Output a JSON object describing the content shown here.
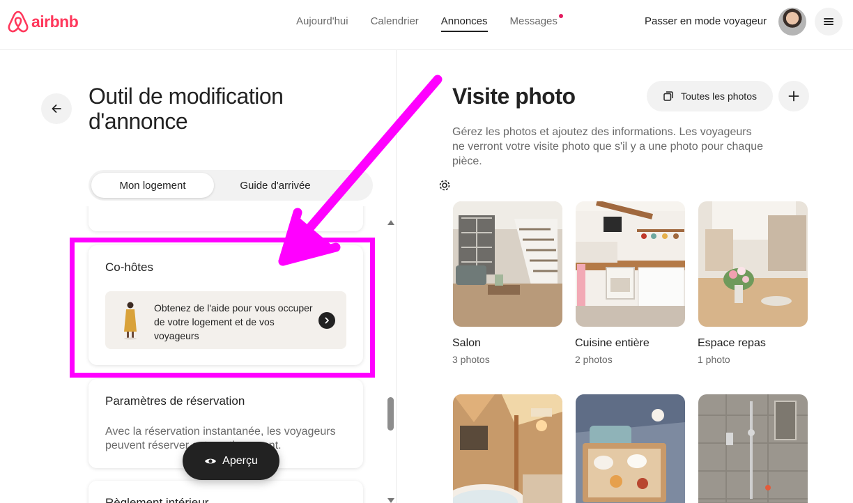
{
  "brand": {
    "name": "airbnb",
    "color": "#ff385c",
    "logo_icon": "airbnb-logo-icon"
  },
  "nav": {
    "items": [
      {
        "label": "Aujourd'hui",
        "active": false
      },
      {
        "label": "Calendrier",
        "active": false
      },
      {
        "label": "Annonces",
        "active": true
      },
      {
        "label": "Messages",
        "active": false,
        "notification": true
      }
    ],
    "switch_mode": "Passer en mode voyageur",
    "menu_icon": "hamburger-menu-icon",
    "avatar_icon": "user-avatar"
  },
  "editor": {
    "back_icon": "arrow-left-icon",
    "title": "Outil de modification d'annonce",
    "tabs": [
      {
        "label": "Mon logement",
        "active": true
      },
      {
        "label": "Guide d'arrivée",
        "active": false
      }
    ],
    "settings_icon": "gear-icon",
    "cards": {
      "cohosts": {
        "title": "Co-hôtes",
        "promo_text": "Obtenez de l'aide pour vous occuper de votre logement et de vos voyageurs",
        "promo_icon": "chevron-right-icon"
      },
      "booking": {
        "title": "Paramètres de réservation",
        "description": "Avec la réservation instantanée, les voyageurs peuvent réserver automatiquement."
      },
      "rules": {
        "title": "Règlement intérieur"
      }
    },
    "preview_button": "Aperçu",
    "preview_icon": "eye-icon"
  },
  "photo_tour": {
    "title": "Visite photo",
    "all_photos_button": "Toutes les photos",
    "all_photos_icon": "photos-stack-icon",
    "add_icon": "plus-icon",
    "description": "Gérez les photos et ajoutez des informations. Les voyageurs ne verront votre visite photo que s'il y a une photo pour chaque pièce.",
    "rooms": [
      {
        "name": "Salon",
        "count": "3 photos"
      },
      {
        "name": "Cuisine entière",
        "count": "2 photos"
      },
      {
        "name": "Espace repas",
        "count": "1 photo"
      },
      {
        "name": "",
        "count": ""
      },
      {
        "name": "",
        "count": ""
      },
      {
        "name": "",
        "count": ""
      }
    ]
  },
  "annotation": {
    "color": "#ff00ff"
  }
}
